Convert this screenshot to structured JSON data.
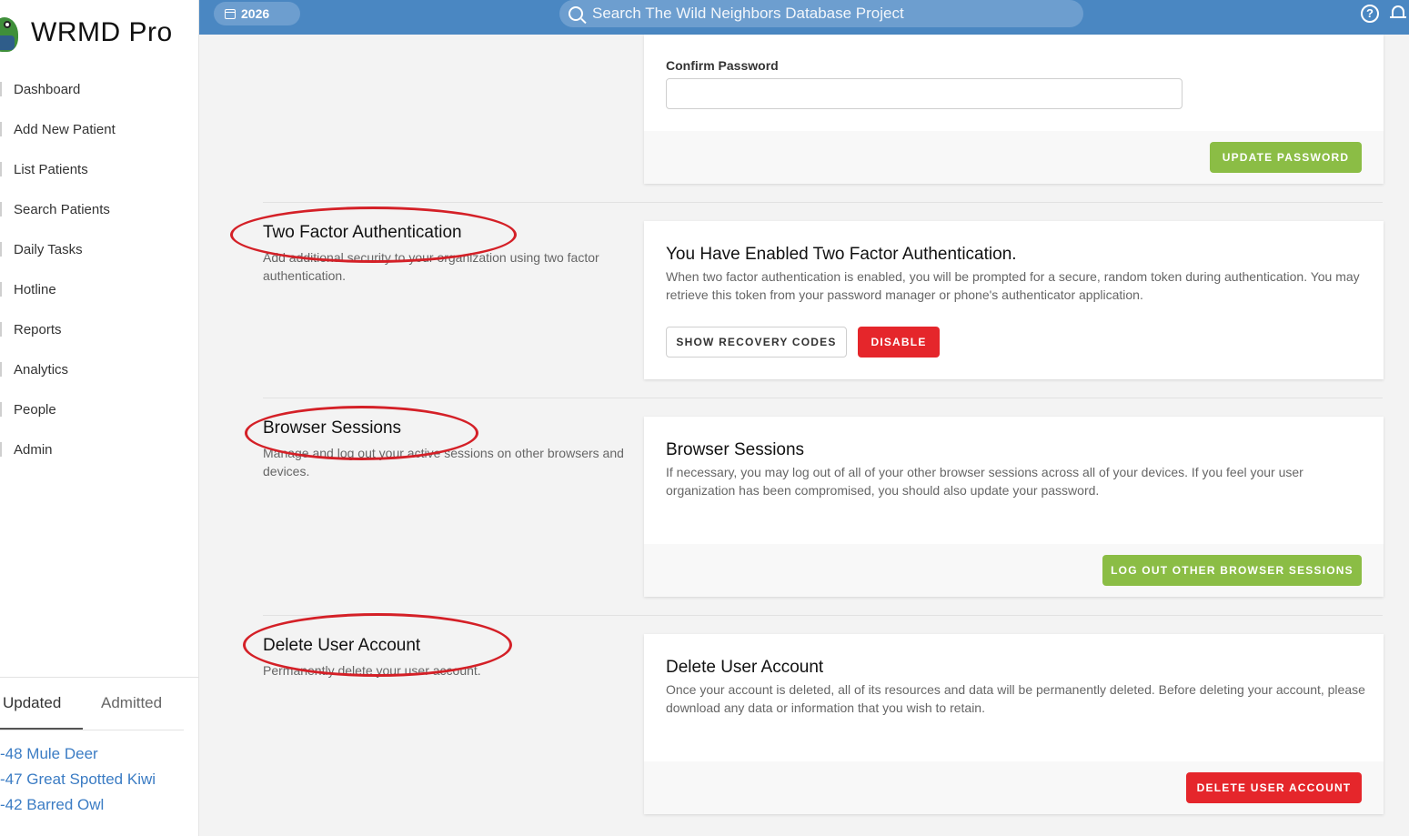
{
  "app": {
    "title": "WRMD Pro"
  },
  "topbar": {
    "year": "2026",
    "search_placeholder": "Search The Wild Neighbors Database Project",
    "help_icon": "question-circle-icon",
    "bell_icon": "bell-icon"
  },
  "sidebar": {
    "items": [
      {
        "label": "Dashboard"
      },
      {
        "label": "Add New Patient"
      },
      {
        "label": "List Patients"
      },
      {
        "label": "Search Patients"
      },
      {
        "label": "Daily Tasks"
      },
      {
        "label": "Hotline"
      },
      {
        "label": "Reports"
      },
      {
        "label": "Analytics"
      },
      {
        "label": "People"
      },
      {
        "label": "Admin"
      }
    ],
    "recent_tabs": [
      {
        "label": "Updated",
        "active": true
      },
      {
        "label": "Admitted",
        "active": false
      }
    ],
    "recent_patients": [
      {
        "label": "-48 Mule Deer"
      },
      {
        "label": "-47 Great Spotted Kiwi"
      },
      {
        "label": "-42 Barred Owl"
      }
    ]
  },
  "password": {
    "confirm_label": "Confirm Password",
    "confirm_value": "",
    "update_button": "UPDATE PASSWORD"
  },
  "two_factor": {
    "title": "Two Factor Authentication",
    "desc": "Add additional security to your organization using two factor authentication.",
    "card_title": "You Have Enabled Two Factor Authentication.",
    "card_text": "When two factor authentication is enabled, you will be prompted for a secure, random token during authentication. You may retrieve this token from your password manager or phone's authenticator application.",
    "recovery_button": "SHOW RECOVERY CODES",
    "disable_button": "DISABLE"
  },
  "browser_sessions": {
    "title": "Browser Sessions",
    "desc": "Manage and log out your active sessions on other browsers and devices.",
    "card_title": "Browser Sessions",
    "card_text": "If necessary, you may log out of all of your other browser sessions across all of your devices. If you feel your user organization has been compromised, you should also update your password.",
    "logout_button": "LOG OUT OTHER BROWSER SESSIONS"
  },
  "delete_account": {
    "title": "Delete User Account",
    "desc": "Permanently delete your user account.",
    "card_title": "Delete User Account",
    "card_text": "Once your account is deleted, all of its resources and data will be permanently deleted. Before deleting your account, please download any data or information that you wish to retain.",
    "delete_button": "DELETE USER ACCOUNT"
  },
  "colors": {
    "topbar": "#4a87c2",
    "accent_green": "#8bbd45",
    "danger_red": "#e5262b",
    "annotation_red": "#d42027",
    "link_blue": "#3b7cc4"
  }
}
